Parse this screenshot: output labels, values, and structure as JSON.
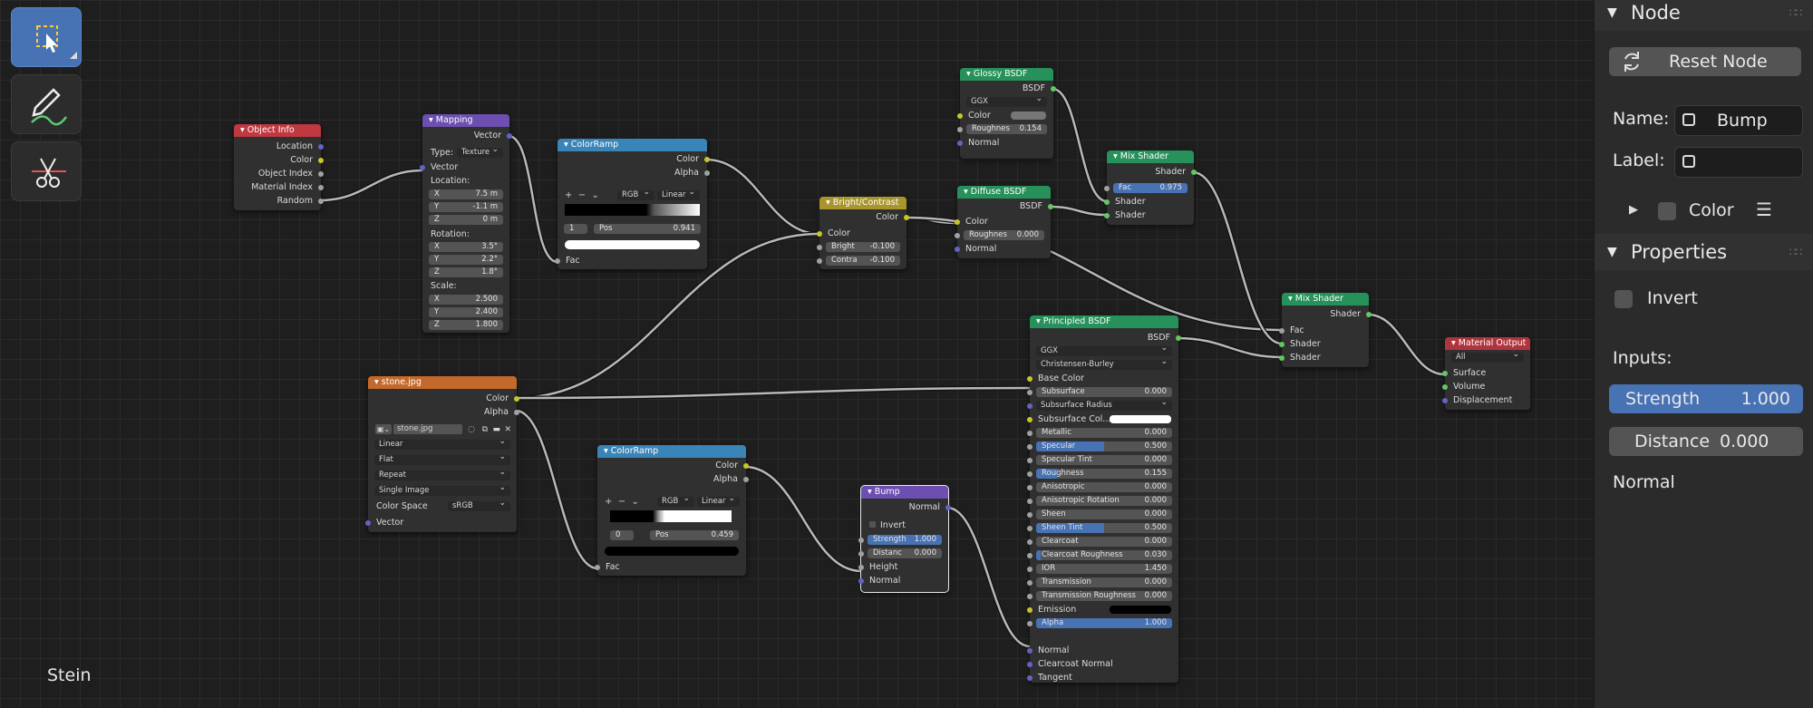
{
  "tools": {
    "select": "select-box-icon",
    "annotate": "annotate-icon",
    "cut": "cut-links-icon"
  },
  "editor_label": "Stein",
  "nodes": {
    "object_info": {
      "title": "Object Info",
      "outputs": [
        "Location",
        "Color",
        "Object Index",
        "Material Index",
        "Random"
      ]
    },
    "mapping": {
      "title": "Mapping",
      "output": "Vector",
      "type_label": "Type:",
      "type_value": "Texture",
      "vector_label": "Vector",
      "location_label": "Location:",
      "location": [
        {
          "axis": "X",
          "value": "7.5 m"
        },
        {
          "axis": "Y",
          "value": "-1.1 m"
        },
        {
          "axis": "Z",
          "value": "0 m"
        }
      ],
      "rotation_label": "Rotation:",
      "rotation": [
        {
          "axis": "X",
          "value": "3.5°"
        },
        {
          "axis": "Y",
          "value": "2.2°"
        },
        {
          "axis": "Z",
          "value": "1.8°"
        }
      ],
      "scale_label": "Scale:",
      "scale": [
        {
          "axis": "X",
          "value": "2.500"
        },
        {
          "axis": "Y",
          "value": "2.400"
        },
        {
          "axis": "Z",
          "value": "1.800"
        }
      ]
    },
    "colorramp1": {
      "title": "ColorRamp",
      "outputs": [
        "Color",
        "Alpha"
      ],
      "mode": "RGB",
      "interp": "Linear",
      "index": "1",
      "pos_label": "Pos",
      "pos": "0.941",
      "input": "Fac"
    },
    "bright_contrast": {
      "title": "Bright/Contrast",
      "output": "Color",
      "input": "Color",
      "bright_label": "Bright",
      "bright": "-0.100",
      "contrast_label": "Contra",
      "contrast": "-0.100"
    },
    "glossy": {
      "title": "Glossy BSDF",
      "output": "BSDF",
      "distribution": "GGX",
      "color_label": "Color",
      "rough_label": "Roughnes",
      "rough": "0.154",
      "normal": "Normal"
    },
    "diffuse": {
      "title": "Diffuse BSDF",
      "output": "BSDF",
      "color_label": "Color",
      "rough_label": "Roughnes",
      "rough": "0.000",
      "normal": "Normal"
    },
    "mix1": {
      "title": "Mix Shader",
      "output": "Shader",
      "fac_label": "Fac",
      "fac": "0.975",
      "in1": "Shader",
      "in2": "Shader"
    },
    "mix2": {
      "title": "Mix Shader",
      "output": "Shader",
      "fac_label": "Fac",
      "in1": "Shader",
      "in2": "Shader"
    },
    "output": {
      "title": "Material Output",
      "target": "All",
      "inputs": [
        "Surface",
        "Volume",
        "Displacement"
      ]
    },
    "image": {
      "title": "stone.jpg",
      "outputs": [
        "Color",
        "Alpha"
      ],
      "file": "stone.jpg",
      "interp": "Linear",
      "projection": "Flat",
      "extension": "Repeat",
      "source": "Single Image",
      "cs_label": "Color Space",
      "cs_value": "sRGB",
      "vector": "Vector"
    },
    "colorramp2": {
      "title": "ColorRamp",
      "outputs": [
        "Color",
        "Alpha"
      ],
      "mode": "RGB",
      "interp": "Linear",
      "index": "0",
      "pos_label": "Pos",
      "pos": "0.459",
      "input": "Fac"
    },
    "bump": {
      "title": "Bump",
      "output": "Normal",
      "invert": "Invert",
      "strength_label": "Strength",
      "strength": "1.000",
      "distance_label": "Distanc",
      "distance": "0.000",
      "height": "Height",
      "normal": "Normal"
    },
    "principled": {
      "title": "Principled BSDF",
      "output": "BSDF",
      "distribution": "GGX",
      "sss_method": "Christensen-Burley",
      "base_color": "Base Color",
      "params": [
        {
          "label": "Subsurface",
          "value": "0.000",
          "fill": 0
        },
        {
          "label": "Subsurface Radius",
          "value": "",
          "dropdown": true
        },
        {
          "label": "Subsurface Col...",
          "value": "",
          "swatch": "#ffffff"
        },
        {
          "label": "Metallic",
          "value": "0.000",
          "fill": 0
        },
        {
          "label": "Specular",
          "value": "0.500",
          "fill": 0.5
        },
        {
          "label": "Specular Tint",
          "value": "0.000",
          "fill": 0
        },
        {
          "label": "Roughness",
          "value": "0.155",
          "fill": 0.155
        },
        {
          "label": "Anisotropic",
          "value": "0.000",
          "fill": 0
        },
        {
          "label": "Anisotropic Rotation",
          "value": "0.000",
          "fill": 0
        },
        {
          "label": "Sheen",
          "value": "0.000",
          "fill": 0
        },
        {
          "label": "Sheen Tint",
          "value": "0.500",
          "fill": 0.5
        },
        {
          "label": "Clearcoat",
          "value": "0.000",
          "fill": 0
        },
        {
          "label": "Clearcoat Roughness",
          "value": "0.030",
          "fill": 0.03
        },
        {
          "label": "IOR",
          "value": "1.450",
          "fill": 0
        },
        {
          "label": "Transmission",
          "value": "0.000",
          "fill": 0
        },
        {
          "label": "Transmission Roughness",
          "value": "0.000",
          "fill": 0
        },
        {
          "label": "Emission",
          "value": "",
          "swatch": "#000000"
        },
        {
          "label": "Alpha",
          "value": "1.000",
          "fill": 1
        }
      ],
      "tail": [
        "Normal",
        "Clearcoat Normal",
        "Tangent"
      ]
    }
  },
  "panel": {
    "node_header": "Node",
    "reset_button": "Reset Node",
    "name_label": "Name:",
    "name_value": "Bump",
    "label_label": "Label:",
    "label_value": "",
    "color_label": "Color",
    "properties_header": "Properties",
    "invert_label": "Invert",
    "inputs_label": "Inputs:",
    "strength_label": "Strength",
    "strength_value": "1.000",
    "strength_fill": 1,
    "distance_label": "Distance",
    "distance_value": "0.000",
    "normal_label": "Normal"
  },
  "colors": {
    "object_info": "#c03840",
    "mapping": "#6c4fb0",
    "colorramp": "#3a85b8",
    "bright_contrast": "#a8962c",
    "shader": "#26915a",
    "output": "#b0343e",
    "image": "#c4692c",
    "vector": "#6c4fb0",
    "accent": "#4772b3"
  }
}
